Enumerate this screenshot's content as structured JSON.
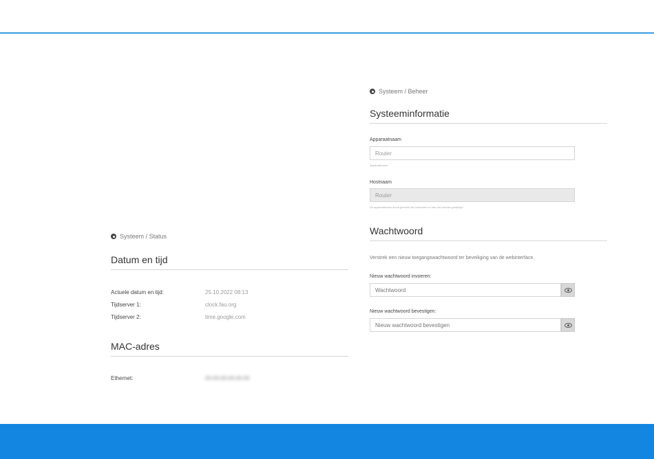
{
  "status_panel": {
    "breadcrumb": "Systeem / Status",
    "datetime_section": {
      "title": "Datum en tijd",
      "rows": [
        {
          "label": "Actuele datum en tijd:",
          "value": "25.10.2022 08:13"
        },
        {
          "label": "Tijdserver 1:",
          "value": "clock.fau.org"
        },
        {
          "label": "Tijdserver 2:",
          "value": "time.google.com"
        }
      ]
    },
    "mac_section": {
      "title": "MAC-adres",
      "rows": [
        {
          "label": "Ethernet:",
          "value": "00:00:00:00:00:00"
        }
      ]
    }
  },
  "beheer_panel": {
    "breadcrumb": "Systeem / Beheer",
    "sysinfo_section": {
      "title": "Systeeminformatie",
      "device_name": {
        "label": "Apparaatnaam",
        "value": "Router",
        "hint": "Apparaatnaam"
      },
      "hostname": {
        "label": "Hostnaam",
        "value": "Router",
        "hint": "De apparaatnaam wordt gebruikt als hostnaam en kan niet worden gewijzigd"
      }
    },
    "password_section": {
      "title": "Wachtwoord",
      "description": "Verstrek een nieuw toegangswachtwoord ter beveiliging van de webinterface.",
      "new_password": {
        "label": "Nieuw wachtwoord invoeren:",
        "placeholder": "Wachtwoord"
      },
      "confirm_password": {
        "label": "Nieuw wachtwoord bevestigen:",
        "placeholder": "Nieuw wachtwoord bevestigen"
      }
    }
  },
  "colors": {
    "accent_line": "#3a9be0",
    "footer_bar": "#1286e0"
  }
}
